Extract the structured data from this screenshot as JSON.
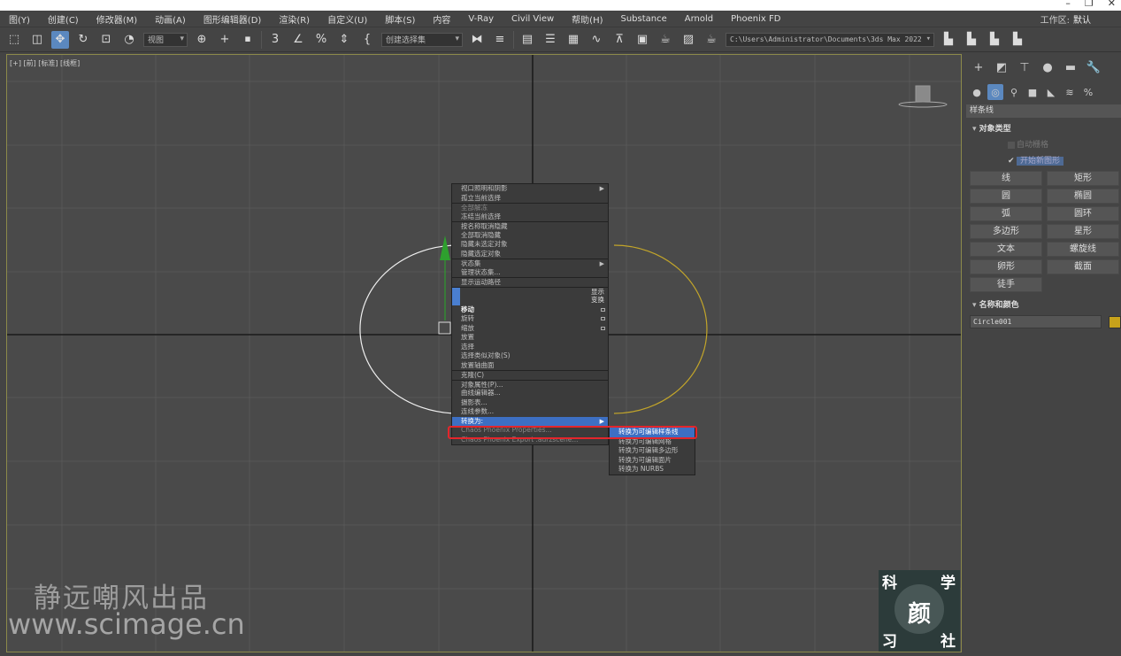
{
  "window": {
    "controls": [
      "–",
      "❐",
      "✕"
    ]
  },
  "menubar": {
    "items": [
      "图(Y)",
      "创建(C)",
      "修改器(M)",
      "动画(A)",
      "图形编辑器(D)",
      "渲染(R)",
      "自定义(U)",
      "脚本(S)",
      "内容",
      "V-Ray",
      "Civil View",
      "帮助(H)",
      "Substance",
      "Arnold",
      "Phoenix FD"
    ],
    "workspace_label": "工作区:",
    "workspace_value": "默认"
  },
  "toolbar": {
    "view_combo": "视图",
    "selection_set_combo": "创建选择集",
    "project_path": "C:\\Users\\Administrator\\Documents\\3ds Max 2022"
  },
  "viewport": {
    "label": "[+] [前] [标准] [线框]"
  },
  "quad_menu": {
    "items": [
      {
        "label": "视口照明和阴影",
        "arrow": true
      },
      {
        "label": "孤立当前选择"
      },
      {
        "label": "全部解冻",
        "grey": true,
        "sep": true
      },
      {
        "label": "冻结当前选择"
      },
      {
        "label": "按名称取消隐藏",
        "sep": true
      },
      {
        "label": "全部取消隐藏"
      },
      {
        "label": "隐藏未选定对象"
      },
      {
        "label": "隐藏选定对象"
      },
      {
        "label": "状态集",
        "arrow": true,
        "sep": true
      },
      {
        "label": "管理状态集..."
      },
      {
        "label": "显示运动路径",
        "sep": true
      }
    ],
    "headers": [
      "显示",
      "变换"
    ],
    "transform_items": [
      {
        "label": "移动",
        "bold": true,
        "box": true
      },
      {
        "label": "旋转",
        "box": true
      },
      {
        "label": "缩放",
        "box": true
      },
      {
        "label": "放置"
      },
      {
        "label": "选择"
      },
      {
        "label": "选择类似对象(S)"
      },
      {
        "label": "放置轴曲面"
      },
      {
        "label": "克隆(C)",
        "sep": true
      },
      {
        "label": "对象属性(P)...",
        "sep": true
      },
      {
        "label": "曲线编辑器..."
      },
      {
        "label": "摄影表..."
      },
      {
        "label": "连线参数..."
      },
      {
        "label": "转换为:",
        "arrow": true,
        "highlight": true
      },
      {
        "label": "Chaos Phoenix Properties...",
        "grey": true
      },
      {
        "label": "Chaos Phoenix Export .aurzscene...",
        "grey": true
      }
    ],
    "submenu": [
      {
        "label": "转换为可编辑样条线",
        "highlight": true
      },
      {
        "label": "转换为可编辑网格"
      },
      {
        "label": "转换为可编辑多边形"
      },
      {
        "label": "转换为可编辑面片"
      },
      {
        "label": "转换为 NURBS"
      }
    ]
  },
  "watermark": {
    "cn_text": "静远嘲风出品",
    "url": "www.scimage.cn",
    "logo_chars": [
      "科",
      "学",
      "颜",
      "习",
      "社"
    ]
  },
  "command_panel": {
    "dropdown": "样条线",
    "object_type_title": "对象类型",
    "auto_grid": "自动栅格",
    "start_new_shape": "开始新图形",
    "shapes": [
      "线",
      "矩形",
      "圆",
      "椭圆",
      "弧",
      "圆环",
      "多边形",
      "星形",
      "文本",
      "螺旋线",
      "卵形",
      "截面",
      "徒手"
    ],
    "name_color_title": "名称和颜色",
    "object_name": "Circle001",
    "object_color": "#c7a21b"
  }
}
